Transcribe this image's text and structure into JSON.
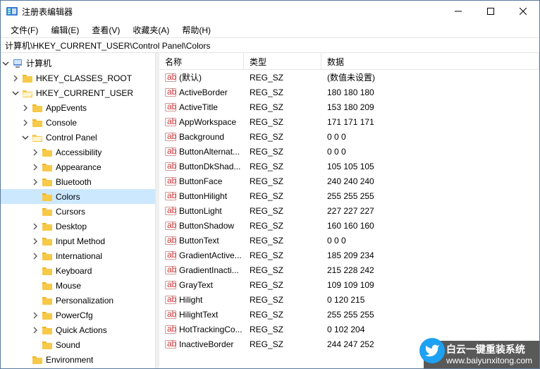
{
  "window": {
    "title": "注册表编辑器"
  },
  "menu": {
    "file": "文件(F)",
    "edit": "编辑(E)",
    "view": "查看(V)",
    "favorites": "收藏夹(A)",
    "help": "帮助(H)"
  },
  "address": "计算机\\HKEY_CURRENT_USER\\Control Panel\\Colors",
  "columns": {
    "name": "名称",
    "type": "类型",
    "data": "数据"
  },
  "tree": {
    "root": "计算机",
    "hives": [
      {
        "label": "HKEY_CLASSES_ROOT",
        "expanded": false
      },
      {
        "label": "HKEY_CURRENT_USER",
        "expanded": true,
        "children": [
          {
            "label": "AppEvents",
            "expanded": false,
            "hasChildren": true
          },
          {
            "label": "Console",
            "expanded": false,
            "hasChildren": true
          },
          {
            "label": "Control Panel",
            "expanded": true,
            "children": [
              {
                "label": "Accessibility",
                "hasChildren": true
              },
              {
                "label": "Appearance",
                "hasChildren": true
              },
              {
                "label": "Bluetooth",
                "hasChildren": true
              },
              {
                "label": "Colors",
                "selected": true
              },
              {
                "label": "Cursors"
              },
              {
                "label": "Desktop",
                "hasChildren": true
              },
              {
                "label": "Input Method",
                "hasChildren": true
              },
              {
                "label": "International",
                "hasChildren": true
              },
              {
                "label": "Keyboard"
              },
              {
                "label": "Mouse"
              },
              {
                "label": "Personalization"
              },
              {
                "label": "PowerCfg",
                "hasChildren": true
              },
              {
                "label": "Quick Actions",
                "hasChildren": true
              },
              {
                "label": "Sound"
              }
            ]
          },
          {
            "label": "Environment"
          }
        ]
      }
    ]
  },
  "values": [
    {
      "name": "(默认)",
      "type": "REG_SZ",
      "data": "(数值未设置)"
    },
    {
      "name": "ActiveBorder",
      "type": "REG_SZ",
      "data": "180 180 180"
    },
    {
      "name": "ActiveTitle",
      "type": "REG_SZ",
      "data": "153 180 209"
    },
    {
      "name": "AppWorkspace",
      "type": "REG_SZ",
      "data": "171 171 171"
    },
    {
      "name": "Background",
      "type": "REG_SZ",
      "data": "0 0 0"
    },
    {
      "name": "ButtonAlternat...",
      "type": "REG_SZ",
      "data": "0 0 0"
    },
    {
      "name": "ButtonDkShad...",
      "type": "REG_SZ",
      "data": "105 105 105"
    },
    {
      "name": "ButtonFace",
      "type": "REG_SZ",
      "data": "240 240 240"
    },
    {
      "name": "ButtonHilight",
      "type": "REG_SZ",
      "data": "255 255 255"
    },
    {
      "name": "ButtonLight",
      "type": "REG_SZ",
      "data": "227 227 227"
    },
    {
      "name": "ButtonShadow",
      "type": "REG_SZ",
      "data": "160 160 160"
    },
    {
      "name": "ButtonText",
      "type": "REG_SZ",
      "data": "0 0 0"
    },
    {
      "name": "GradientActive...",
      "type": "REG_SZ",
      "data": "185 209 234"
    },
    {
      "name": "GradientInacti...",
      "type": "REG_SZ",
      "data": "215 228 242"
    },
    {
      "name": "GrayText",
      "type": "REG_SZ",
      "data": "109 109 109"
    },
    {
      "name": "Hilight",
      "type": "REG_SZ",
      "data": "0 120 215"
    },
    {
      "name": "HilightText",
      "type": "REG_SZ",
      "data": "255 255 255"
    },
    {
      "name": "HotTrackingCo...",
      "type": "REG_SZ",
      "data": "0 102 204"
    },
    {
      "name": "InactiveBorder",
      "type": "REG_SZ",
      "data": "244 247 252"
    }
  ],
  "watermark": {
    "line1": "白云一键重装系统",
    "line2": "www.baiyunxitong.com"
  }
}
